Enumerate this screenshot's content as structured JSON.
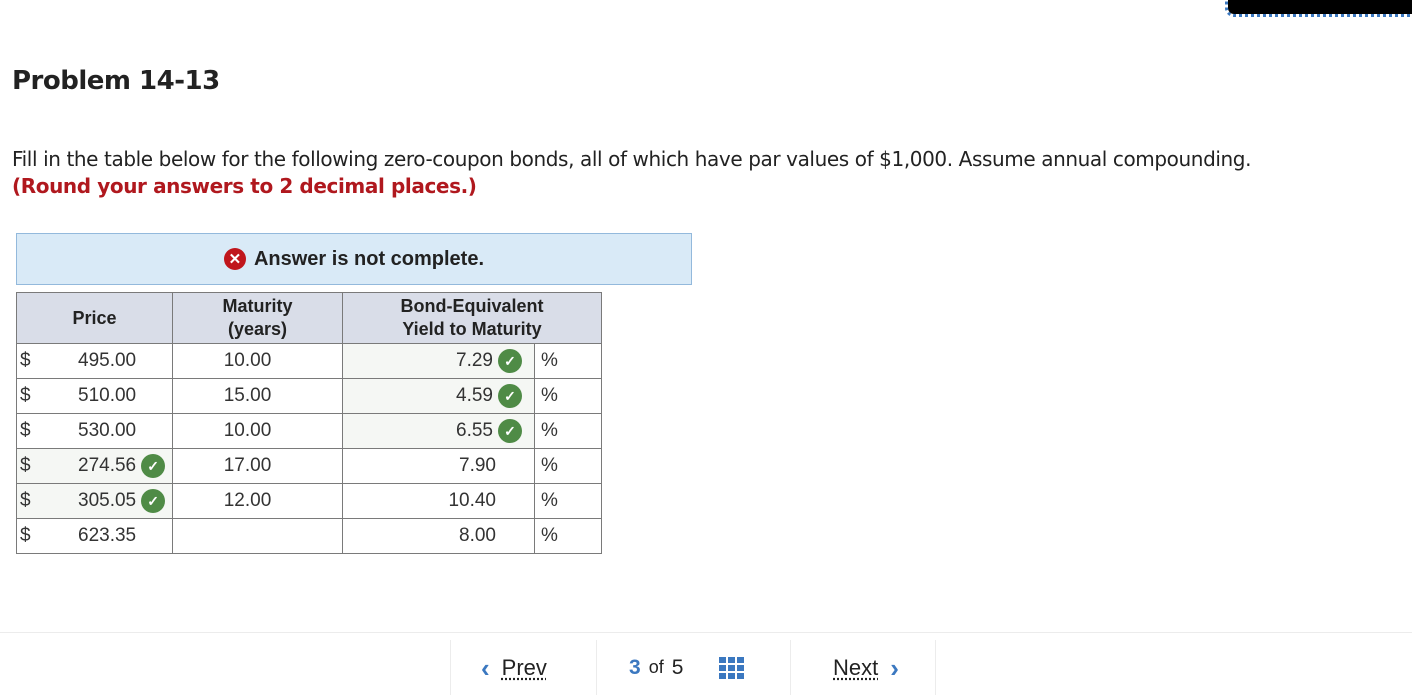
{
  "problem": {
    "title": "Problem 14-13",
    "instructions": "Fill in the table below for the following zero-coupon bonds, all of which have par values of $1,000. Assume annual compounding.",
    "emphasis": "(Round your answers to 2 decimal places.)"
  },
  "status": {
    "icon": "x-circle-icon",
    "message": "Answer is not complete."
  },
  "table": {
    "headers": {
      "price": "Price",
      "maturity_line1": "Maturity",
      "maturity_line2": "(years)",
      "yield_line1": "Bond-Equivalent",
      "yield_line2": "Yield to Maturity"
    },
    "currency_symbol": "$",
    "percent_symbol": "%",
    "rows": [
      {
        "price": "495.00",
        "price_checked": false,
        "maturity": "10.00",
        "yield": "7.29",
        "yield_checked": true
      },
      {
        "price": "510.00",
        "price_checked": false,
        "maturity": "15.00",
        "yield": "4.59",
        "yield_checked": true
      },
      {
        "price": "530.00",
        "price_checked": false,
        "maturity": "10.00",
        "yield": "6.55",
        "yield_checked": true
      },
      {
        "price": "274.56",
        "price_checked": true,
        "maturity": "17.00",
        "yield": "7.90",
        "yield_checked": false
      },
      {
        "price": "305.05",
        "price_checked": true,
        "maturity": "12.00",
        "yield": "10.40",
        "yield_checked": false
      },
      {
        "price": "623.35",
        "price_checked": false,
        "maturity": "",
        "yield": "8.00",
        "yield_checked": false
      }
    ]
  },
  "pager": {
    "prev_label": "Prev",
    "next_label": "Next",
    "current": "3",
    "of_label": "of",
    "total": "5"
  },
  "colors": {
    "accent": "#3b78c0",
    "error": "#c0161c",
    "correct": "#4f8b46",
    "emphasis_text": "#b0181e",
    "banner_bg": "#d9eaf7"
  }
}
